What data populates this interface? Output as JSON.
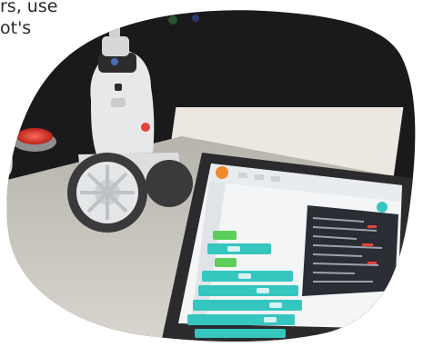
{
  "caption": {
    "line1": "rs, use",
    "line2": "ot's"
  },
  "colors": {
    "background": "#ffffff",
    "scene_dark": "#1c1c1e",
    "tablet_frame": "#2b2b2e",
    "block_teal": "#35c6c0",
    "block_green": "#5ccf5a",
    "code_panel": "#2a2d33",
    "robot_white": "#e9ebed",
    "accent_red": "#e0443c",
    "accent_orange": "#f08a2c"
  },
  "icons": [
    "robot",
    "tablet",
    "button-red"
  ]
}
